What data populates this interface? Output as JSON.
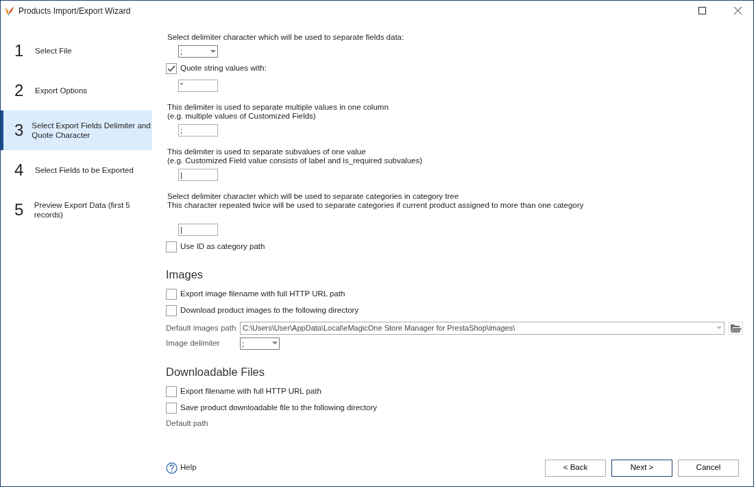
{
  "window": {
    "title": "Products Import/Export Wizard"
  },
  "steps": [
    {
      "number": "1",
      "label": "Select File",
      "selected": false
    },
    {
      "number": "2",
      "label": "Export Options",
      "selected": false
    },
    {
      "number": "3",
      "label": "Select Export Fields Delimiter and Quote Character",
      "selected": true
    },
    {
      "number": "4",
      "label": "Select Fields to be Exported",
      "selected": false
    },
    {
      "number": "5",
      "label": "Preview Export Data (first 5 records)",
      "selected": false
    }
  ],
  "content": [
    {
      "kind": "label",
      "lines": [
        "Select delimiter character which will be used to separate fields data:"
      ]
    },
    {
      "kind": "select",
      "value": ";"
    },
    {
      "kind": "checkbox",
      "label": "Quote string values with:",
      "checked": true
    },
    {
      "kind": "input",
      "value": "\""
    },
    {
      "kind": "label",
      "lines": [
        "This delimiter is used to separate multiple values in one column",
        "(e.g. multiple values of Customized Fields)"
      ]
    },
    {
      "kind": "input",
      "value": ";"
    },
    {
      "kind": "label",
      "lines": [
        "This delimiter is used to separate subvalues of one value",
        "(e.g. Customized Field value consists of label and is_required subvalues)"
      ]
    },
    {
      "kind": "input",
      "value": "|"
    },
    {
      "kind": "label",
      "lines": [
        "Select delimiter character which will be used to separate categories in category tree",
        "This character repeated twice will be used to separate categories if current product assigned to more than one category"
      ]
    },
    {
      "kind": "input",
      "value": "|"
    },
    {
      "kind": "checkbox",
      "label": "Use ID as category path",
      "checked": false
    },
    {
      "kind": "heading",
      "text": "Images"
    },
    {
      "kind": "checkbox",
      "label": "Export image filename with full HTTP URL path",
      "checked": false
    },
    {
      "kind": "checkbox",
      "label": "Download product images to the following directory",
      "checked": false
    },
    {
      "kind": "path",
      "label": "Default images path",
      "value": "C:\\Users\\User\\AppData\\Local\\eMagicOne Store Manager for PrestaShop\\images\\"
    },
    {
      "kind": "labeled-select",
      "label": "Image delimiter",
      "value": ";"
    },
    {
      "kind": "heading",
      "text": "Downloadable Files"
    },
    {
      "kind": "checkbox",
      "label": "Export filename with full HTTP URL path",
      "checked": false
    },
    {
      "kind": "checkbox",
      "label": "Save product downloadable file to the following directory",
      "checked": false
    },
    {
      "kind": "cut-label",
      "text": "Default path"
    }
  ],
  "footer": {
    "help": "Help",
    "buttons": [
      {
        "label": "< Back",
        "primary": false
      },
      {
        "label": "Next >",
        "primary": true
      },
      {
        "label": "Cancel",
        "primary": false
      }
    ]
  }
}
